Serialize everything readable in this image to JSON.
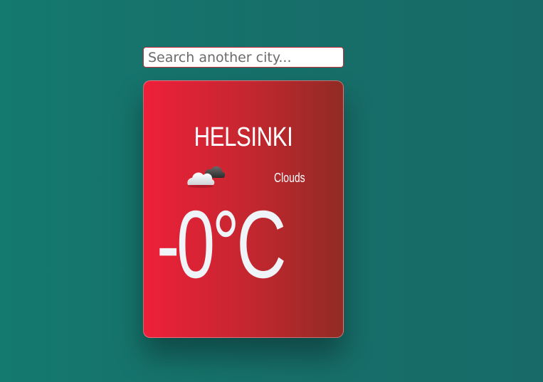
{
  "search": {
    "placeholder": "Search another city..."
  },
  "weather": {
    "city": "HELSINKI",
    "description": "Clouds",
    "temperature": "-0°C",
    "icon": "clouds-icon"
  },
  "colors": {
    "background": "#14796f",
    "card_start": "#ee2039",
    "card_end": "#912b24",
    "search_border": "#c2323e"
  }
}
